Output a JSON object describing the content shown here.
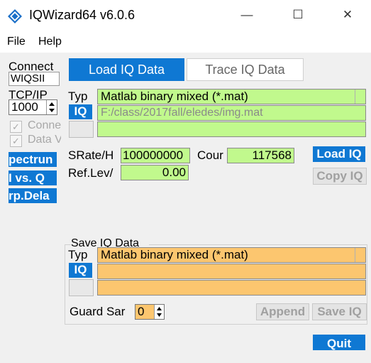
{
  "window": {
    "title": "IQWizard64 v6.0.6",
    "minimize_glyph": "—",
    "maximize_glyph": "☐",
    "close_glyph": "✕",
    "accent_color": "#0f78d3"
  },
  "menu": {
    "file": "File",
    "help": "Help"
  },
  "left": {
    "connect_label": "Connect",
    "instrument_value": "WIQSII",
    "tcpip_label": "TCP/IP",
    "port_value": "1000",
    "check_connect": "Conne",
    "check_data": "Data V",
    "btn_spectrum": "pectrun",
    "btn_ivsq": "I vs. Q",
    "btn_grpdelay": "rp.Dela"
  },
  "tabs": {
    "load": "Load IQ Data",
    "trace": "Trace IQ Data"
  },
  "load": {
    "type_label": "Typ",
    "type_value": "Matlab binary mixed (*.mat)",
    "iq_button": "IQ",
    "file_path": "F:/class/2017fall/eledes/img.mat",
    "file_path2": "",
    "srate_label": "SRate/H",
    "srate_value": "100000000",
    "count_label": "Cour",
    "count_value": "117568",
    "reflev_label": "Ref.Lev/",
    "reflev_value": "0.00",
    "load_button": "Load IQ",
    "copy_button": "Copy IQ"
  },
  "save": {
    "group_title": "Save IQ Data",
    "type_label": "Typ",
    "type_value": "Matlab binary mixed (*.mat)",
    "iq_button": "IQ",
    "file_path": "",
    "file_path2": "",
    "guard_label": "Guard Sar",
    "guard_value": "0",
    "append_button": "Append",
    "save_button": "Save IQ"
  },
  "quit_button": "Quit",
  "colors": {
    "green_field": "#c1f98d",
    "orange_field": "#fcc66f",
    "disabled_text": "#a8a8a8"
  }
}
